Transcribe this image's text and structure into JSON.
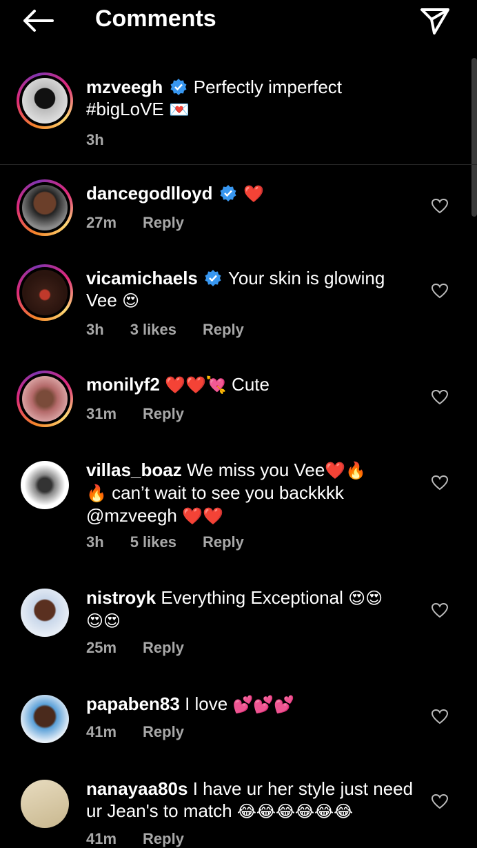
{
  "header": {
    "title": "Comments"
  },
  "caption": {
    "username": "mzveegh",
    "text_line1": "Perfectly imperfect",
    "text_line2": "#bigLoVE",
    "emoji": "💌",
    "time": "3h"
  },
  "comments": [
    {
      "username": "dancegodlloyd",
      "text": "",
      "emoji": "❤️",
      "time": "27m",
      "likes": "",
      "reply": "Reply"
    },
    {
      "username": "vicamichaels",
      "text": "Your skin is glowing",
      "text2": "Vee",
      "emoji": "😍",
      "time": "3h",
      "likes": "3 likes",
      "reply": "Reply"
    },
    {
      "username": "monilyf2",
      "emoji": "❤️❤️💘",
      "text": "Cute",
      "time": "31m",
      "likes": "",
      "reply": "Reply"
    },
    {
      "username": "villas_boaz",
      "text": "We miss you Vee",
      "emoji1": "❤️🔥",
      "line2_emoji": "🔥",
      "line2": "can’t wait to see you backkkk",
      "line3": "@mzveegh",
      "emoji3": "❤️❤️",
      "time": "3h",
      "likes": "5 likes",
      "reply": "Reply"
    },
    {
      "username": "nistroyk",
      "text": "Everything Exceptional",
      "emoji": "😍😍",
      "emoji2": "😍😍",
      "time": "25m",
      "likes": "",
      "reply": "Reply"
    },
    {
      "username": "papaben83",
      "text": "I love",
      "emoji": "💕💕💕",
      "time": "41m",
      "likes": "",
      "reply": "Reply"
    },
    {
      "username": "nanayaa80s",
      "text": "I have ur her style just need",
      "text2": "ur Jean's to match",
      "emoji": "😂😂😂😂😂😂",
      "time": "41m",
      "likes": "",
      "reply": "Reply"
    }
  ],
  "colors": {
    "background": "#000000",
    "verified": "#3897f0",
    "meta": "#a8a8a8"
  }
}
